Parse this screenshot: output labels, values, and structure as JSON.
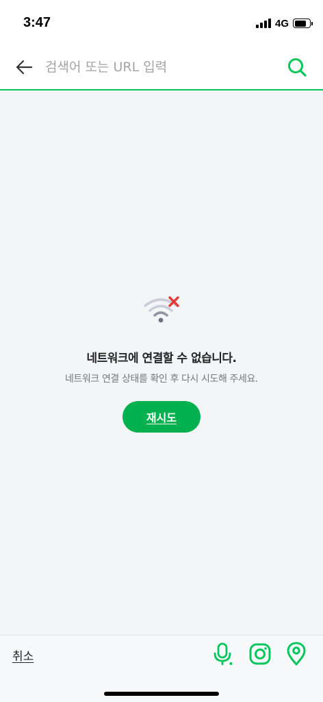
{
  "status_bar": {
    "time": "3:47",
    "network": "4G",
    "signal_bars": 4,
    "battery_level": 0.8
  },
  "search": {
    "placeholder": "검색어 또는 URL 입력",
    "value": "",
    "back_icon": "arrow-left-icon",
    "search_icon": "search-icon"
  },
  "error": {
    "icon": "wifi-off-icon",
    "title": "네트워크에 연결할 수 없습니다.",
    "description": "네트워크 연결 상태를 확인 후 다시 시도해 주세요.",
    "retry_label": "재시도"
  },
  "bottom_bar": {
    "cancel_label": "취소",
    "tools": [
      "microphone-icon",
      "camera-lens-icon",
      "location-pin-icon"
    ]
  },
  "colors": {
    "accent": "#03c75a",
    "retry_button": "#03b24f",
    "error_mark": "#e53935",
    "wifi_icon": "#c9ced8"
  }
}
